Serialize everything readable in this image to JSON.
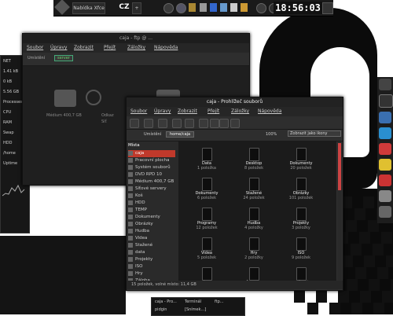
{
  "top_panel": {
    "task_label": "Nabídka Xfce",
    "keyboard_layout": "CZ",
    "clock": "18:56:03"
  },
  "back_window": {
    "title": "caja - ftp @ ...",
    "menus": [
      "Soubor",
      "Úpravy",
      "Zobrazit",
      "Přejít",
      "Záložky",
      "Nápověda"
    ],
    "address": "Umístění",
    "path": "server",
    "items": [
      {
        "name": "Médium 400,7 GB"
      },
      {
        "name": "Odkaz"
      },
      {
        "name": "Síť"
      }
    ]
  },
  "front_window": {
    "title": "caja - Prohlížeč souborů",
    "menus": [
      "Soubor",
      "Úpravy",
      "Zobrazit",
      "Přejít",
      "Záložky",
      "Nápověda"
    ],
    "location_label": "Umístění",
    "path_button": "home/caja",
    "zoom": "100%",
    "view_mode": "Zobrazit jako ikony",
    "sidebar_header": "Místa",
    "sidebar": [
      "caja",
      "Pracovní plocha",
      "Systém souborů",
      "DVD RPD 10",
      "Médium 400,7 GB",
      "Síťové servery",
      "Koš",
      "HDD",
      "TEMP",
      "Dokumenty",
      "Obrázky",
      "Hudba",
      "Videa",
      "Stažené",
      "data",
      "Projekty",
      "ISO",
      "Hry",
      "Záloha"
    ],
    "files": [
      {
        "name": "Data",
        "count": "1 položka"
      },
      {
        "name": "Desktop",
        "count": "8 položek"
      },
      {
        "name": "Dokumenty",
        "count": "20 položek"
      },
      {
        "name": "Dokumenty",
        "count": "6 položek"
      },
      {
        "name": "Stažené",
        "count": "24 položek"
      },
      {
        "name": "Obrázky",
        "count": "101 položek"
      },
      {
        "name": "Programy",
        "count": "12 položek"
      },
      {
        "name": "Hudba",
        "count": "4 položky"
      },
      {
        "name": "Projekty",
        "count": "3 položky"
      },
      {
        "name": "Videa",
        "count": "5 položek"
      },
      {
        "name": "Hry",
        "count": "2 položky"
      },
      {
        "name": "ISO",
        "count": "9 položek"
      },
      {
        "name": "Zálohy",
        "count": "4 položky"
      },
      {
        "name": "Šablony",
        "count": "0 položek"
      },
      {
        "name": "Veřejné",
        "count": "1 položka"
      }
    ],
    "status": "15 položek, volné místo: 11,4 GB"
  },
  "taskbar": {
    "tasks": [
      "caja - Pro...",
      "Terminál",
      "ftp...",
      "pidgin",
      "[Snímek...]"
    ]
  },
  "conky": {
    "lines": [
      "NET",
      "1.41 kB",
      "0 kB",
      "5.56 GB",
      "Processes",
      "CPU",
      "RAM",
      "Swap",
      "HDD",
      "/home",
      "Uptime"
    ]
  }
}
